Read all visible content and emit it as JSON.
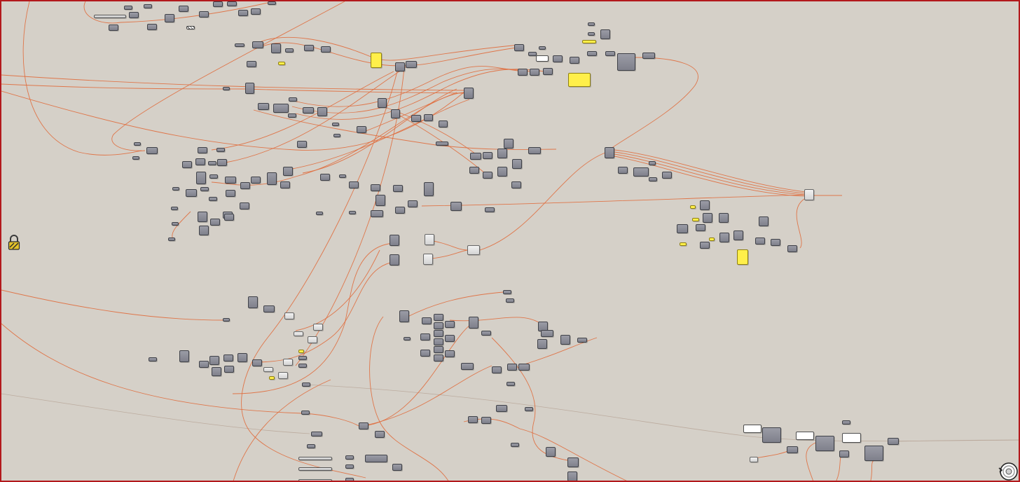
{
  "app": {
    "view": "grasshopper-definition-canvas",
    "accent_border": "#b3191c",
    "canvas_background": "#d5d0c8"
  },
  "colors": {
    "wire": "#e06c3c",
    "wire_faint": "#b9a79a",
    "component": "#8a8b96",
    "panel": "#ffef4a",
    "output_panel": "#ffffff"
  },
  "icons": {
    "lock": "lock-icon",
    "navigation_wheel": "navigation-wheel-icon"
  },
  "canvas": {
    "component_kinds": [
      "component",
      "panel",
      "white",
      "pale",
      "slider",
      "hatch"
    ]
  }
}
